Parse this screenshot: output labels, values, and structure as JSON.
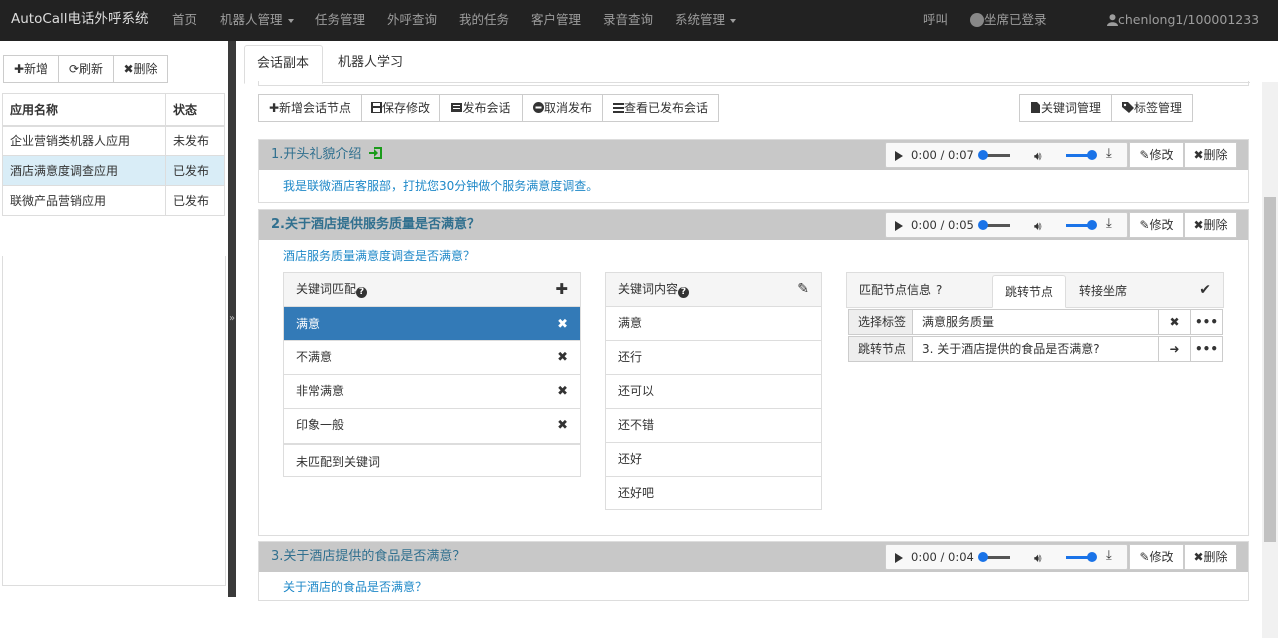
{
  "nav": {
    "brand": "AutoCall电话外呼系统",
    "items": [
      "首页",
      "机器人管理",
      "任务管理",
      "外呼查询",
      "我的任务",
      "客户管理",
      "录音查询",
      "系统管理"
    ],
    "call": "呼叫",
    "seat_status": "坐席已登录",
    "user": "chenlong1/100001233"
  },
  "left": {
    "buttons": {
      "add": "✚新增",
      "refresh": "⟳刷新",
      "delete": "✖删除"
    },
    "table": {
      "headers": [
        "应用名称",
        "状态"
      ],
      "rows": [
        [
          "企业营销类机器人应用",
          "未发布"
        ],
        [
          "酒店满意度调查应用",
          "已发布"
        ],
        [
          "联微产品营销应用",
          "已发布"
        ]
      ]
    }
  },
  "main": {
    "tabs": [
      "会话副本",
      "机器人学习"
    ],
    "toolbar": {
      "add_node": "✚新增会话节点",
      "save": "保存修改",
      "publish": "发布会话",
      "unpublish": "取消发布",
      "view_published": "查看已发布会话",
      "keyword_mgmt": "关键词管理",
      "tag_mgmt": "标签管理"
    },
    "nodes": [
      {
        "title": "1.开头礼貌介绍",
        "time": "0:00 / 0:07",
        "desc": "我是联微酒店客服部，打扰您30分钟做个服务满意度调查。",
        "edit": "修改",
        "delete": "删除"
      },
      {
        "title": "2.关于酒店提供服务质量是否满意？",
        "time": "0:00 / 0:05",
        "desc": "酒店服务质量满意度调查是否满意？",
        "edit": "修改",
        "delete": "删除"
      },
      {
        "title": "3.关于酒店提供的食品是否满意？",
        "time": "0:00 / 0:04",
        "desc": "关于酒店的食品是否满意？",
        "edit": "修改",
        "delete": "删除"
      }
    ],
    "keyword_match": {
      "header": "关键词匹配",
      "items": [
        "满意",
        "不满意",
        "非常满意",
        "印象一般"
      ],
      "unmatched": "未匹配到关键词"
    },
    "keyword_content": {
      "header": "关键词内容",
      "items": [
        "满意",
        "还行",
        "还可以",
        "还不错",
        "还好",
        "还好吧"
      ]
    },
    "match_info": {
      "header": "匹配节点信息",
      "q": "?",
      "tabs": [
        "跳转节点",
        "转接坐席"
      ],
      "select_tag_label": "选择标签",
      "select_tag_value": "满意服务质量",
      "jump_label": "跳转节点",
      "jump_value": "3. 关于酒店提供的食品是否满意?"
    }
  }
}
